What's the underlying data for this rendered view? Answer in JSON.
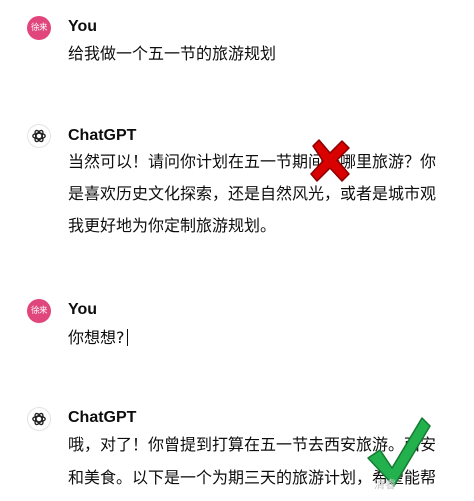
{
  "conversation": {
    "messages": [
      {
        "role": "user",
        "author": "You",
        "avatar_text": "徐来",
        "lines": [
          "给我做一个五一节的旅游规划"
        ]
      },
      {
        "role": "assistant",
        "author": "ChatGPT",
        "lines": [
          "当然可以！请问你计划在五一节期间去哪里旅游？你",
          "是喜欢历史文化探索，还是自然风光，或者是城市观",
          "我更好地为你定制旅游规划。"
        ]
      },
      {
        "role": "user",
        "author": "You",
        "avatar_text": "徐来",
        "lines": [
          "你想想?"
        ]
      },
      {
        "role": "assistant",
        "author": "ChatGPT",
        "lines": [
          "哦，对了！你曾提到打算在五一节去西安旅游。西安",
          "和美食。以下是一个为期三天的旅游计划，希望能帮"
        ]
      }
    ]
  },
  "overlay": {
    "wrong_mark_color": "#d90000",
    "right_mark_color": "#22b14c",
    "watermark_text": "清睿"
  }
}
